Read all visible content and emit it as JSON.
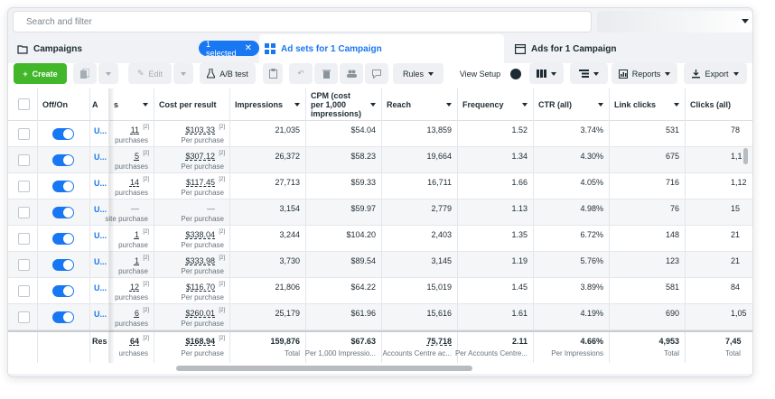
{
  "search": {
    "placeholder": "Search and filter"
  },
  "tabs": {
    "campaigns": "Campaigns",
    "selected_pill": "1 selected",
    "adsets": "Ad sets for 1 Campaign",
    "ads": "Ads for 1 Campaign"
  },
  "toolbar": {
    "create": "Create",
    "edit": "Edit",
    "ab_test": "A/B test",
    "rules": "Rules",
    "view_setup": "View Setup",
    "reports": "Reports",
    "export": "Export"
  },
  "columns": {
    "offon": "Off/On",
    "a": "A",
    "results": "s",
    "cost": "Cost per result",
    "impressions": "Impressions",
    "cpm": "CPM (cost per 1,000 impressions)",
    "reach": "Reach",
    "frequency": "Frequency",
    "ctr": "CTR (all)",
    "link_clicks": "Link clicks",
    "clicks_all": "Clicks (all)"
  },
  "rows": [
    {
      "name": "U...",
      "results": "11",
      "results_sub": "purchases",
      "cost": "$103.33",
      "cost_sub": "Per purchase",
      "impressions": "21,035",
      "cpm": "$54.04",
      "reach": "13,859",
      "frequency": "1.52",
      "ctr": "3.74%",
      "link_clicks": "531",
      "clicks_all": "78"
    },
    {
      "name": "U...",
      "results": "5",
      "results_sub": "purchases",
      "cost": "$307.12",
      "cost_sub": "Per purchase",
      "impressions": "26,372",
      "cpm": "$58.23",
      "reach": "19,664",
      "frequency": "1.34",
      "ctr": "4.30%",
      "link_clicks": "675",
      "clicks_all": "1,1"
    },
    {
      "name": "U...",
      "results": "14",
      "results_sub": "purchases",
      "cost": "$117.45",
      "cost_sub": "Per purchase",
      "impressions": "27,713",
      "cpm": "$59.33",
      "reach": "16,711",
      "frequency": "1.66",
      "ctr": "4.05%",
      "link_clicks": "716",
      "clicks_all": "1,12"
    },
    {
      "name": "U...",
      "results": "—",
      "results_sub": "site purchase",
      "cost": "—",
      "cost_sub": "Per purchase",
      "impressions": "3,154",
      "cpm": "$59.97",
      "reach": "2,779",
      "frequency": "1.13",
      "ctr": "4.98%",
      "link_clicks": "76",
      "clicks_all": "15"
    },
    {
      "name": "U...",
      "results": "1",
      "results_sub": "purchase",
      "cost": "$338.04",
      "cost_sub": "Per purchase",
      "impressions": "3,244",
      "cpm": "$104.20",
      "reach": "2,403",
      "frequency": "1.35",
      "ctr": "6.72%",
      "link_clicks": "148",
      "clicks_all": "21"
    },
    {
      "name": "U...",
      "results": "1",
      "results_sub": "purchase",
      "cost": "$333.98",
      "cost_sub": "Per purchase",
      "impressions": "3,730",
      "cpm": "$89.54",
      "reach": "3,145",
      "frequency": "1.19",
      "ctr": "5.76%",
      "link_clicks": "123",
      "clicks_all": "21"
    },
    {
      "name": "U...",
      "results": "12",
      "results_sub": "purchases",
      "cost": "$116.70",
      "cost_sub": "Per purchase",
      "impressions": "21,806",
      "cpm": "$64.22",
      "reach": "15,019",
      "frequency": "1.45",
      "ctr": "3.89%",
      "link_clicks": "581",
      "clicks_all": "84"
    },
    {
      "name": "U...",
      "results": "6",
      "results_sub": "purchases",
      "cost": "$260.01",
      "cost_sub": "Per purchase",
      "impressions": "25,179",
      "cpm": "$61.96",
      "reach": "15,616",
      "frequency": "1.61",
      "ctr": "4.19%",
      "link_clicks": "690",
      "clicks_all": "1,05"
    }
  ],
  "totals": {
    "label": "Res",
    "results": "64",
    "results_sub": "urchases",
    "cost": "$168.94",
    "cost_sub": "Per purchase",
    "impressions": "159,876",
    "impressions_sub": "Total",
    "cpm": "$67.63",
    "cpm_sub": "Per 1,000 Impressio...",
    "reach": "75,718",
    "reach_sub": "Accounts Centre ac...",
    "frequency": "2.11",
    "frequency_sub": "Per Accounts Centre...",
    "ctr": "4.66%",
    "ctr_sub": "Per Impressions",
    "link_clicks": "4,953",
    "link_clicks_sub": "Total",
    "clicks_all": "7,45",
    "clicks_all_sub": "Total"
  },
  "footnote": "[2]",
  "colors": {
    "accent": "#1877f2",
    "create": "#42b72a"
  }
}
